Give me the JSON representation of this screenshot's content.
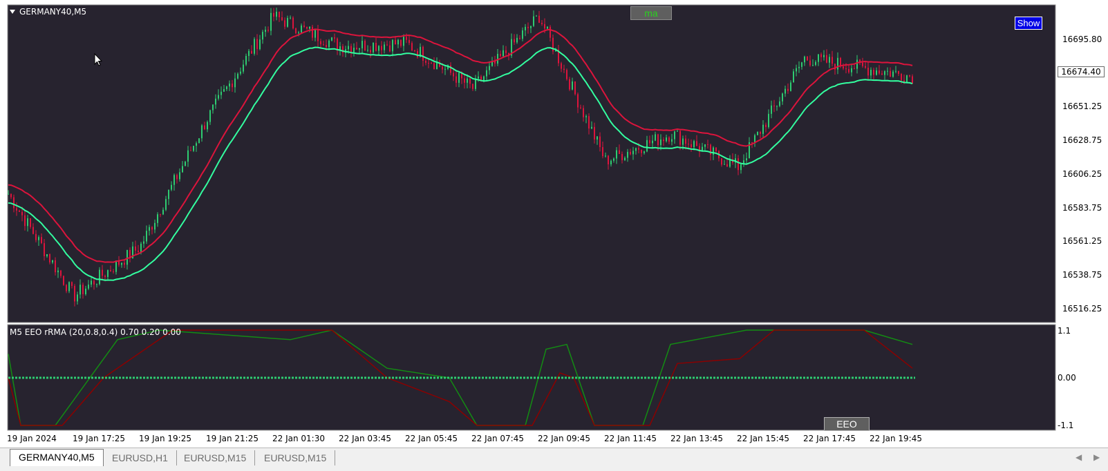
{
  "main_pane": {
    "title": "GERMANY40,M5",
    "ma_button": "ma",
    "show_button": "Show",
    "current_price": "16674.40",
    "price_labels": [
      "16695.80",
      "16651.25",
      "16628.75",
      "16606.25",
      "16583.75",
      "16561.25",
      "16538.75",
      "16516.25"
    ]
  },
  "indicator_pane": {
    "title": "M5 EEO rRMA (20,0.8,0.4) 0.70 0.20 0.00",
    "button": "EEO",
    "labels": [
      "1.1",
      "0.00",
      "-1.1"
    ]
  },
  "time_axis": [
    "19 Jan 2024",
    "19 Jan 17:25",
    "19 Jan 19:25",
    "19 Jan 21:25",
    "22 Jan 01:30",
    "22 Jan 03:45",
    "22 Jan 05:45",
    "22 Jan 07:45",
    "22 Jan 09:45",
    "22 Jan 11:45",
    "22 Jan 13:45",
    "22 Jan 15:45",
    "22 Jan 17:45",
    "22 Jan 19:45"
  ],
  "tabs": [
    {
      "label": "GERMANY40,M5",
      "active": true
    },
    {
      "label": "EURUSD,H1",
      "active": false
    },
    {
      "label": "EURUSD,M15",
      "active": false
    },
    {
      "label": "EURUSD,M15",
      "active": false
    }
  ],
  "colors": {
    "chart_bg": "#27232f",
    "bull": "#2ecc71",
    "bear": "#dc143c",
    "ma_up": "#33ffa0",
    "ma_down": "#dc143c",
    "ind_green": "#138c13",
    "ind_dark_red": "#8b0000"
  },
  "chart_data": {
    "type": "line",
    "title": "GERMANY40,M5",
    "ylim": [
      16505,
      16715
    ],
    "x": [
      "19 Jan 2024",
      "19 Jan 17:25",
      "19 Jan 19:25",
      "19 Jan 21:25",
      "22 Jan 01:30",
      "22 Jan 03:45",
      "22 Jan 05:45",
      "22 Jan 07:45",
      "22 Jan 09:45",
      "22 Jan 11:45",
      "22 Jan 13:45",
      "22 Jan 15:45",
      "22 Jan 17:45",
      "22 Jan 19:45"
    ],
    "series": [
      {
        "name": "price",
        "values": [
          16590,
          16522,
          16555,
          16640,
          16708,
          16688,
          16690,
          16660,
          16708,
          16612,
          16630,
          16608,
          16680,
          16668
        ]
      }
    ]
  }
}
